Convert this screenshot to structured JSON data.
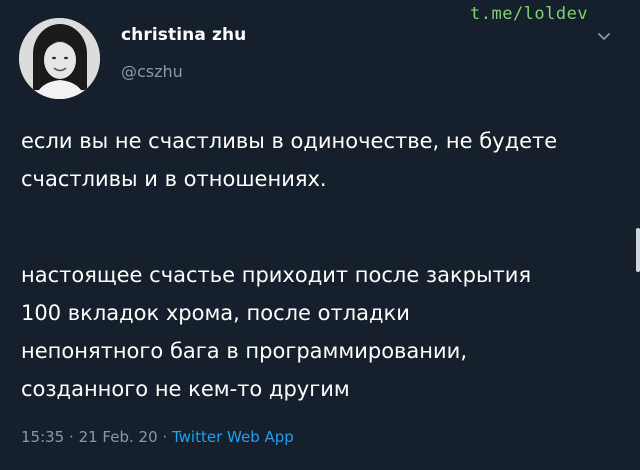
{
  "watermark": "t.me/loldev",
  "author": {
    "display_name": "christina zhu",
    "handle": "@cszhu"
  },
  "tweet": {
    "paragraphs": [
      {
        "lines": [
          "если вы не счастливы в одиночестве, не будете",
          "счастливы и в отношениях."
        ]
      },
      {
        "lines": [
          "настоящее счастье приходит после закрытия",
          "100 вкладок хрома, после отладки",
          "непонятного бага в программировании,",
          "созданного не кем-то другим"
        ]
      }
    ]
  },
  "meta": {
    "time": "15:35",
    "separator": "·",
    "date": "21 Feb. 20",
    "source": "Twitter Web App"
  },
  "icons": {
    "menu": "chevron-down-icon"
  },
  "colors": {
    "background": "#16202c",
    "text": "#ffffff",
    "muted": "#8899a6",
    "link": "#1da1f2",
    "watermark": "#7fd36b"
  }
}
